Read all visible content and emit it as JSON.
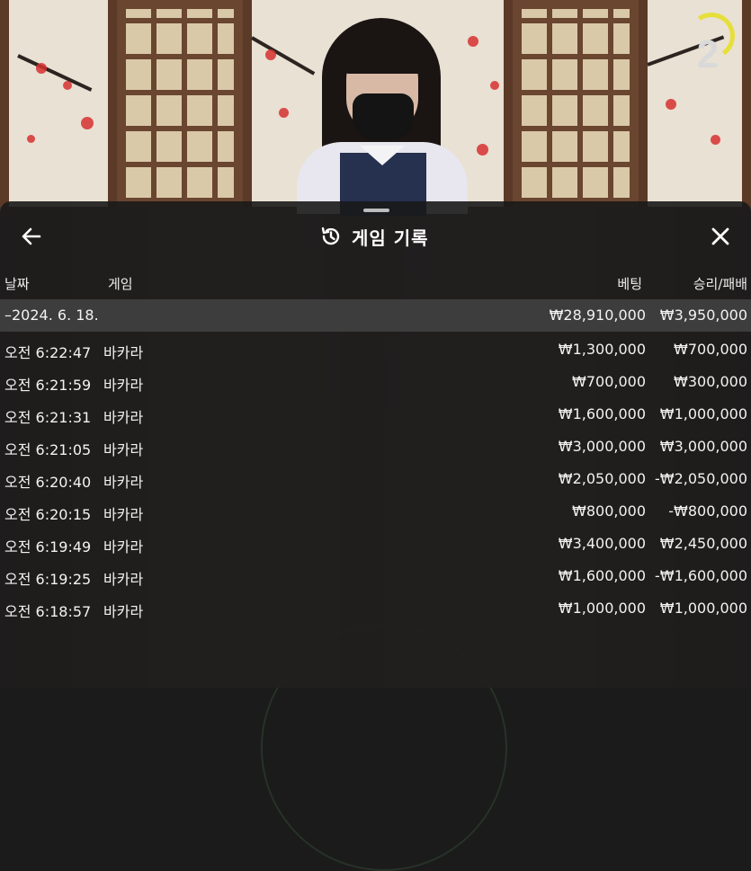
{
  "stream": {
    "round_number": "2"
  },
  "sheet": {
    "title": "게임 기록",
    "back_icon": "arrow-left-icon",
    "close_icon": "close-icon",
    "history_icon": "history-icon"
  },
  "columns": {
    "date": "날짜",
    "game": "게임",
    "bet": "베팅",
    "result": "승리/패배"
  },
  "summary": {
    "date": "–2024. 6. 18.",
    "bet": "₩28,910,000",
    "result": "₩3,950,000"
  },
  "rows": [
    {
      "time": "오전 6:22:47",
      "game": "바카라",
      "bet": "₩1,300,000",
      "result": "₩700,000"
    },
    {
      "time": "오전 6:21:59",
      "game": "바카라",
      "bet": "₩700,000",
      "result": "₩300,000"
    },
    {
      "time": "오전 6:21:31",
      "game": "바카라",
      "bet": "₩1,600,000",
      "result": "₩1,000,000"
    },
    {
      "time": "오전 6:21:05",
      "game": "바카라",
      "bet": "₩3,000,000",
      "result": "₩3,000,000"
    },
    {
      "time": "오전 6:20:40",
      "game": "바카라",
      "bet": "₩2,050,000",
      "result": "-₩2,050,000"
    },
    {
      "time": "오전 6:20:15",
      "game": "바카라",
      "bet": "₩800,000",
      "result": "-₩800,000"
    },
    {
      "time": "오전 6:19:49",
      "game": "바카라",
      "bet": "₩3,400,000",
      "result": "₩2,450,000"
    },
    {
      "time": "오전 6:19:25",
      "game": "바카라",
      "bet": "₩1,600,000",
      "result": "-₩1,600,000"
    },
    {
      "time": "오전 6:18:57",
      "game": "바카라",
      "bet": "₩1,000,000",
      "result": "₩1,000,000"
    }
  ],
  "colors": {
    "sheet_bg": "#1a1a1a",
    "summary_bg": "#3d3d3d",
    "round_arc": "#e6df3a"
  }
}
